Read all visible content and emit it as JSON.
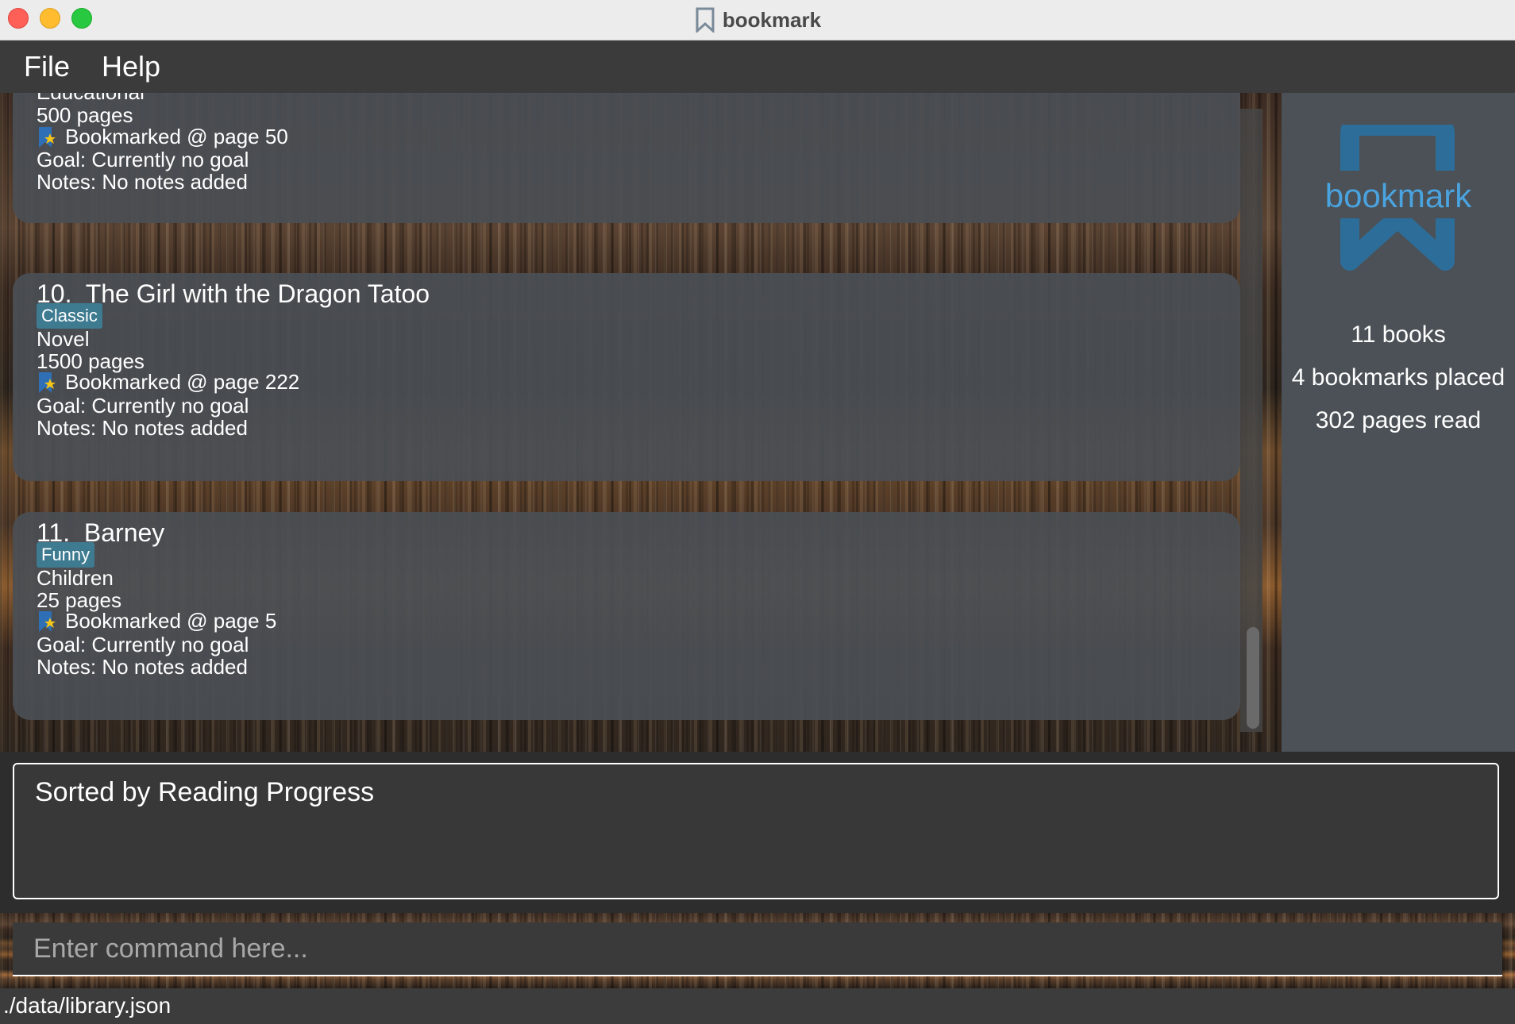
{
  "window": {
    "title": "bookmark"
  },
  "menu": {
    "file": "File",
    "help": "Help"
  },
  "books": [
    {
      "genre": "Educational",
      "pages": "500 pages",
      "bookmark": "Bookmarked @ page 50",
      "goal": "Goal: Currently no goal",
      "notes": "Notes: No notes added"
    },
    {
      "index": "10.",
      "title": "The Girl with the Dragon Tatoo",
      "tag": "Classic",
      "genre": "Novel",
      "pages": "1500 pages",
      "bookmark": "Bookmarked @ page 222",
      "goal": "Goal: Currently no goal",
      "notes": "Notes: No notes added"
    },
    {
      "index": "11.",
      "title": "Barney",
      "tag": "Funny",
      "genre": "Children",
      "pages": "25 pages",
      "bookmark": "Bookmarked @ page 5",
      "goal": "Goal: Currently no goal",
      "notes": "Notes: No notes added"
    }
  ],
  "stats": {
    "logo_text": "bookmark",
    "books": "11 books",
    "bookmarks": "4 bookmarks placed",
    "pages_read": "302 pages read"
  },
  "result": {
    "text": "Sorted by Reading Progress"
  },
  "command": {
    "placeholder": "Enter command here...",
    "value": ""
  },
  "status": {
    "path": "./data/library.json"
  },
  "colors": {
    "card_bg": "#4a4f54",
    "tag_bg": "#3e7b91",
    "logo_blue": "#2d6d99",
    "logo_text": "#4aa3df"
  }
}
